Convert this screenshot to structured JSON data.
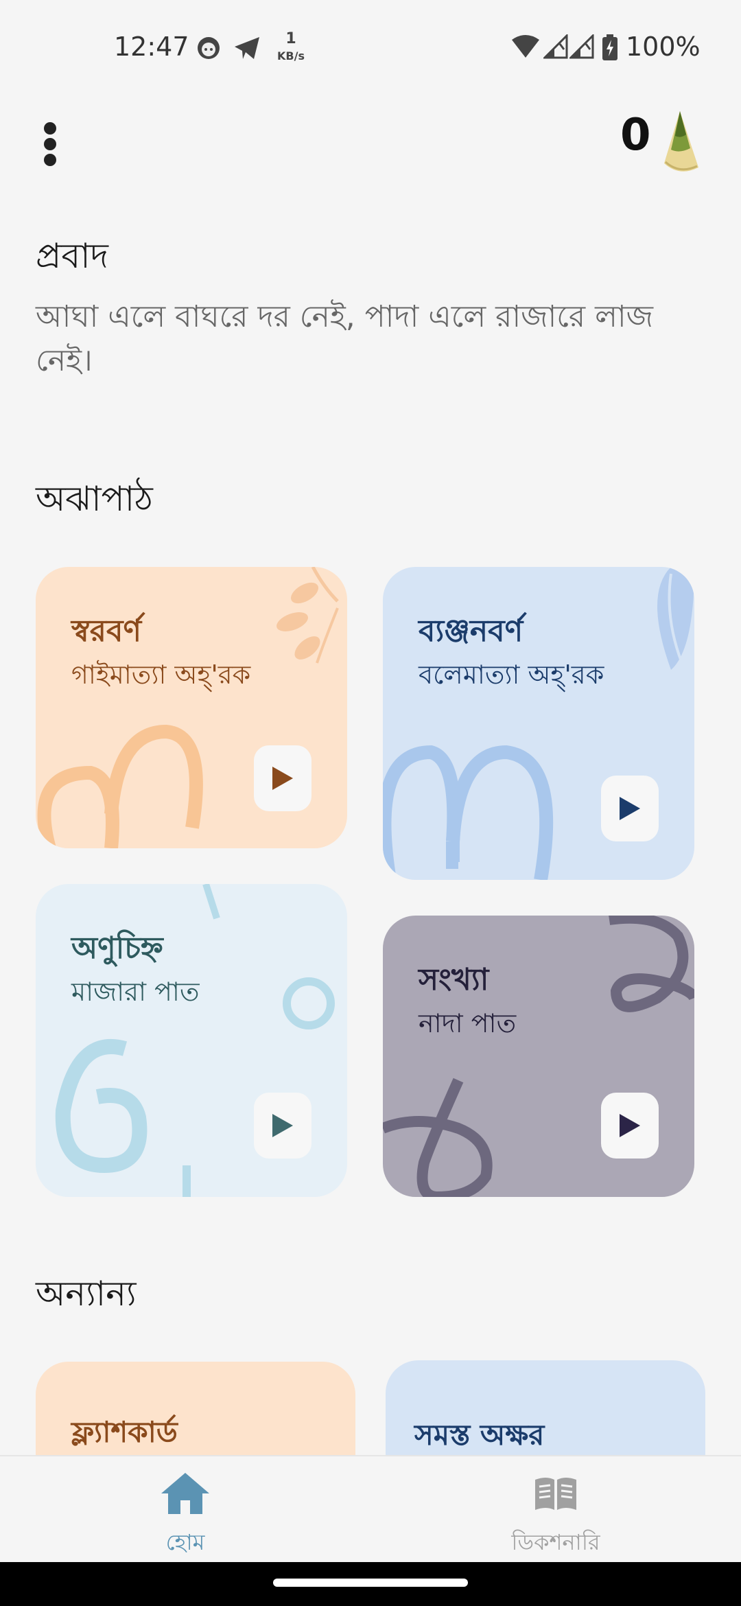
{
  "status_bar": {
    "time": "12:47",
    "net_speed_value": "1",
    "net_speed_unit": "KB/s",
    "battery": "100%",
    "icons": [
      "face-icon",
      "telegram-icon",
      "wifi-icon",
      "signal-icon",
      "signal-icon",
      "battery-charging-icon"
    ]
  },
  "top_bar": {
    "menu_icon": "more-vert-icon",
    "score": "0",
    "mascot_icon": "bamboo-shoot-icon"
  },
  "proverb": {
    "title": "প্রবাদ",
    "text": "আঘা এলে বাঘরে দর নেই, পাদা এলে রাজারে লাজ নেই।"
  },
  "lessons": {
    "title": "অঝাপাঠ",
    "cards": [
      {
        "title": "স্বরবর্ণ",
        "subtitle": "গাইমাত্যা অহ্'রক",
        "bg": "#fde3cc",
        "fg": "#8a4a1c",
        "play_color": "#8a4a1c",
        "play_icon": "play-icon"
      },
      {
        "title": "ব্যঞ্জনবর্ণ",
        "subtitle": "বলেমাত্যা অহ্'রক",
        "bg": "#d6e4f5",
        "fg": "#1b3c6b",
        "play_color": "#1b3c6b",
        "play_icon": "play-icon"
      },
      {
        "title": "অণুচিহ্ন",
        "subtitle": "মাজারা পাত",
        "bg": "#e6f0f7",
        "fg": "#2e5a5e",
        "play_color": "#3f6a6e",
        "play_icon": "play-icon"
      },
      {
        "title": "সংখ্যা",
        "subtitle": "নাদা পাত",
        "bg": "#aba7b5",
        "fg": "#24203a",
        "play_color": "#2b2447",
        "play_icon": "play-icon"
      }
    ]
  },
  "others": {
    "title": "অন্যান্য",
    "cards": [
      {
        "title": "ফ্ল্যাশকার্ড",
        "bg": "#fde3cc",
        "fg": "#8a4a1c"
      },
      {
        "title": "সমস্ত অক্ষর",
        "bg": "#d6e4f5",
        "fg": "#1b3c6b"
      }
    ]
  },
  "bottom_nav": {
    "items": [
      {
        "label": "হোম",
        "icon": "home-icon",
        "active": true,
        "color": "#5b93b3"
      },
      {
        "label": "ডিকশনারি",
        "icon": "book-icon",
        "active": false,
        "color": "#a0a0a0"
      }
    ]
  }
}
